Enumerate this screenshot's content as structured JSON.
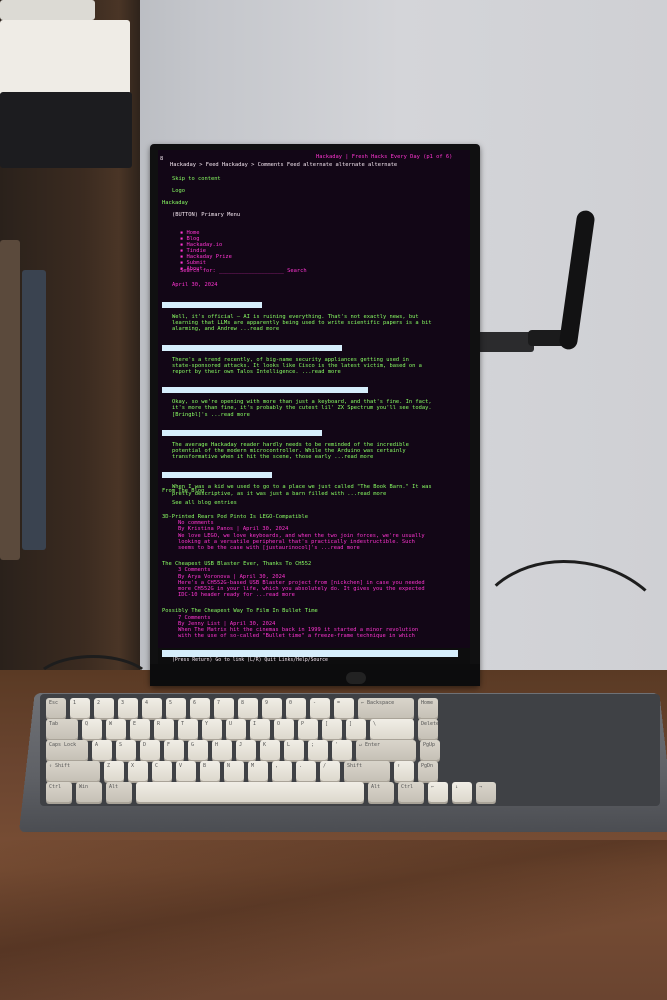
{
  "screen": {
    "header_title": "Hackaday | Fresh Hacks Every Day (p1 of 6)",
    "breadcrumb": "Hackaday > Feed Hackaday > Comments Feed alternate alternate alternate",
    "skip_link": "Skip to content",
    "logo": "Logo",
    "site_name": "Hackaday",
    "menu_button": "(BUTTON) Primary Menu",
    "nav_items": [
      "Home",
      "Blog",
      "Hackaday.io",
      "Tindie",
      "Hackaday Prize",
      "Submit",
      "About"
    ],
    "search_prompt": "Search for: ____________________ Search",
    "date": "April 30, 2024",
    "articles": [
      "Well, it's official — AI is ruining everything. That's not exactly news, but\nlearning that LLMs are apparently being used to write scientific papers is a bit\nalarming, and Andrew ...read more",
      "There's a trend recently, of big-name security appliances getting used in\nstate-sponsored attacks. It looks like Cisco is the latest victim, based on a\nreport by their own Talos Intelligence. ...read more",
      "Okay, so we're opening with more than just a keyboard, and that's fine. In fact,\nit's more than fine, it's probably the cutest lil' ZX Spectrum you'll see today.\n[Bringbl]'s ...read more",
      "The average Hackaday reader hardly needs to be reminded of the incredible\npotential of the modern microcontroller. While the Arduino was certainly\ntransformative when it hit the scene, those early ...read more",
      "When I was a kid we used to go to a place we just called \"The Book Barn.\" It was\npretty descriptive, as it was just a barn filled with ...read more"
    ],
    "from_blog": "From The Blog",
    "see_all": "See all blog entries",
    "blog_posts": [
      {
        "title": "3D-Printed Rears Pod Pinto Is LEGO-Compatible",
        "comments": "No comments",
        "byline": "By Kristina Panos | April 30, 2024",
        "body": "We love LEGO, we love keyboards, and when the two join forces, we're usually\nlooking at a versatile peripheral that's practically indestructible. Such\nseems to be the case with [justaurinocol]'s ...read more"
      },
      {
        "title": "The Cheapest USB Blaster Ever, Thanks To CH552",
        "comments": "3 Comments",
        "byline": "By Arya Voronova | April 30, 2024",
        "body": "Here's a CH552G-based USB Blaster project from [nickchen] in case you needed\nmore CH552G in your life, which you absolutely do. It gives you the expected\nIDC-10 header ready for ...read more"
      },
      {
        "title": "Possibly The Cheapest Way To Film In Bullet Time",
        "comments": "7 Comments",
        "byline": "By Jenny List | April 30, 2024",
        "body": "When The Matrix hit the cinemas back in 1999 it started a minor revolution\nwith the use of so-called \"Bullet time\" a freeze-frame technique in which"
      }
    ],
    "status_line": "(Press Return) Go to link (L/R) Quit Links/Help/Source"
  },
  "keyboard": {
    "rows": [
      [
        "Esc",
        "1",
        "2",
        "3",
        "4",
        "5",
        "6",
        "7",
        "8",
        "9",
        "0",
        "-",
        "=",
        "← Backspace",
        "Home"
      ],
      [
        "Tab",
        "Q",
        "W",
        "E",
        "R",
        "T",
        "Y",
        "U",
        "I",
        "O",
        "P",
        "[",
        "]",
        "\\",
        "Delete"
      ],
      [
        "Caps Lock",
        "A",
        "S",
        "D",
        "F",
        "G",
        "H",
        "J",
        "K",
        "L",
        ";",
        "'",
        "↵ Enter",
        "PgUp"
      ],
      [
        "⇧ Shift",
        "Z",
        "X",
        "C",
        "V",
        "B",
        "N",
        "M",
        ",",
        ".",
        "/",
        "Shift",
        "↑",
        "PgDn"
      ],
      [
        "Ctrl",
        "Win",
        "Alt",
        "",
        "Alt",
        "Ctrl",
        "←",
        "↓",
        "→"
      ]
    ]
  },
  "colors": {
    "screen_bg": "#120616",
    "text_magenta": "#ff35d2",
    "text_green": "#8aff64",
    "highlight_bar": "#d6eefc"
  }
}
